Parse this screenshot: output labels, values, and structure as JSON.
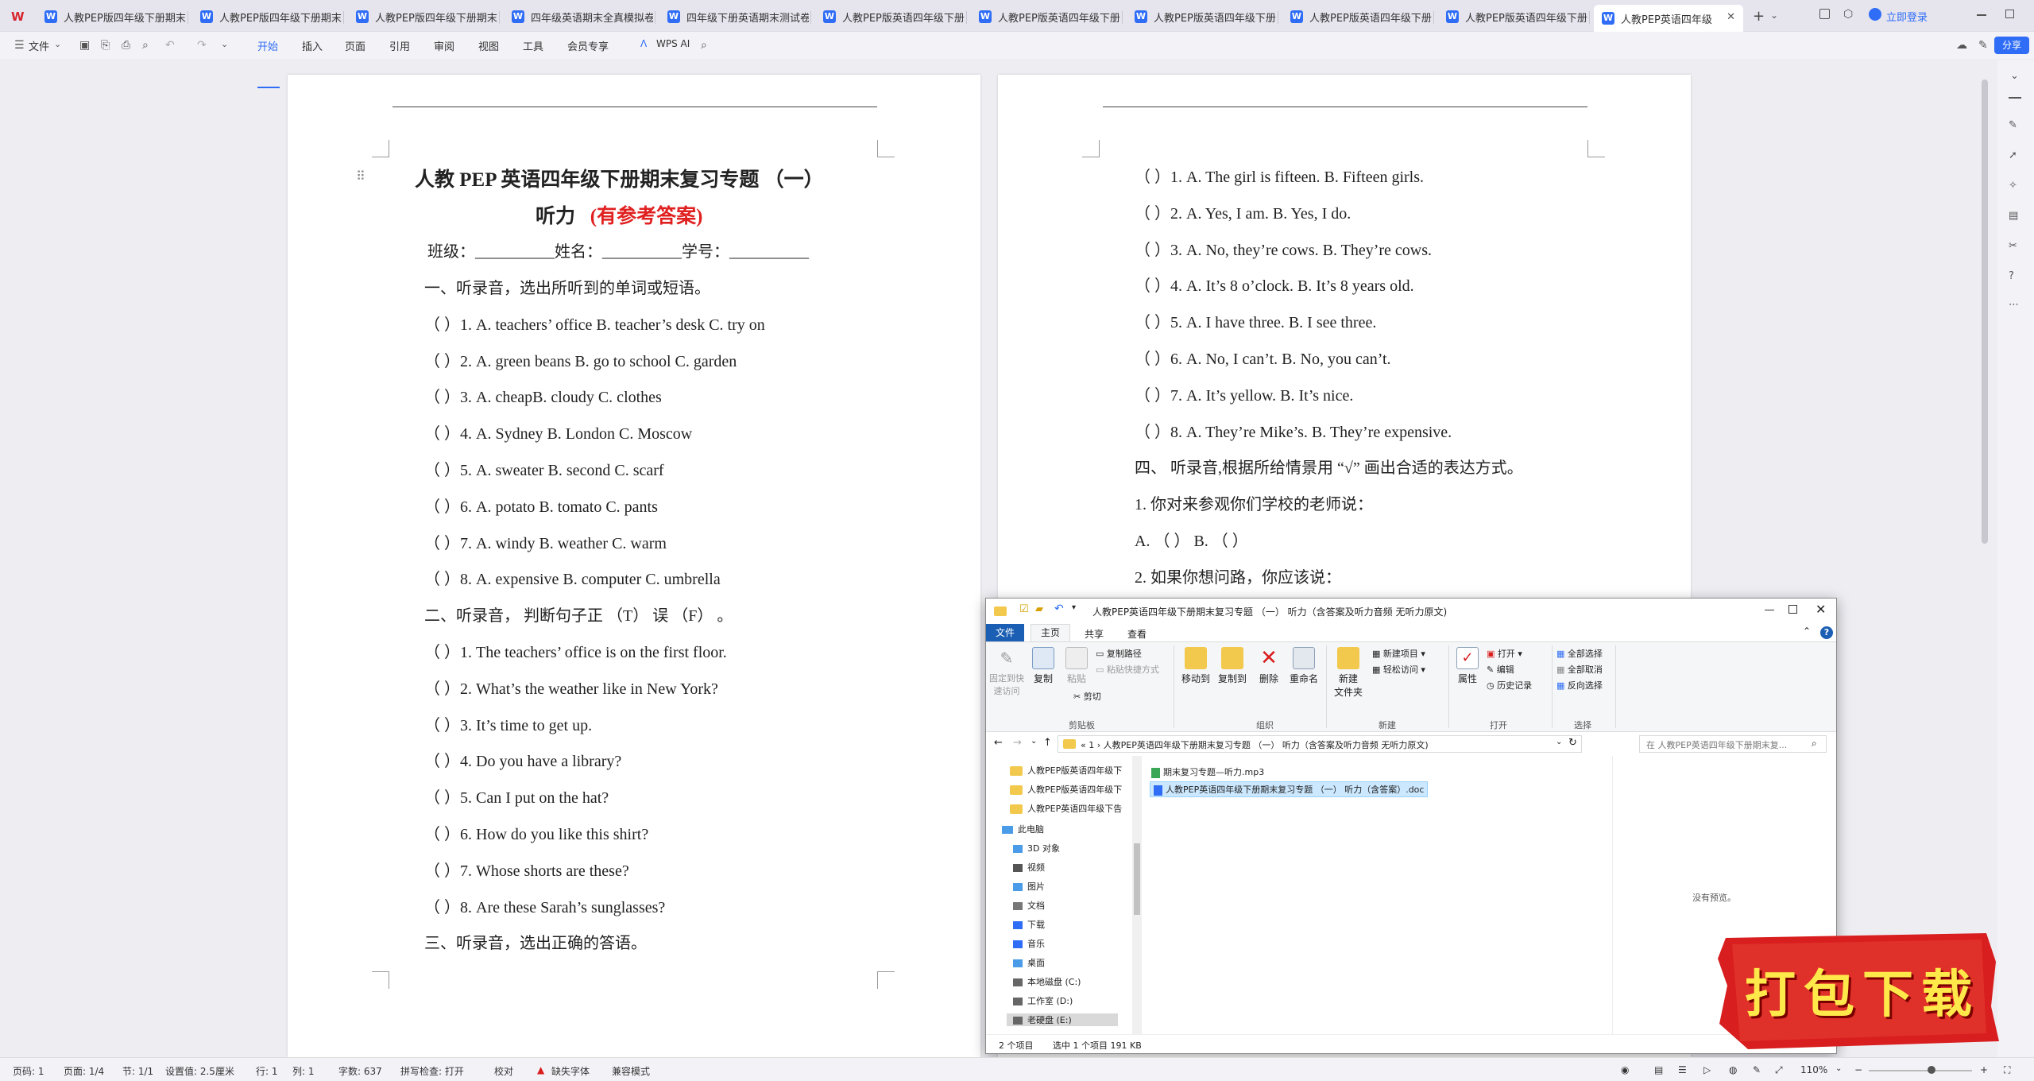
{
  "tabs": [
    {
      "label": "人教PEP版四年级下册期末"
    },
    {
      "label": "人教PEP版四年级下册期末"
    },
    {
      "label": "人教PEP版四年级下册期末"
    },
    {
      "label": "四年级英语期末全真模拟卷"
    },
    {
      "label": "四年级下册英语期末测试卷"
    },
    {
      "label": "人教PEP版英语四年级下册"
    },
    {
      "label": "人教PEP版英语四年级下册"
    },
    {
      "label": "人教PEP版英语四年级下册"
    },
    {
      "label": "人教PEP版英语四年级下册"
    },
    {
      "label": "人教PEP版英语四年级下册"
    },
    {
      "label": "人教PEP英语四年级"
    }
  ],
  "login": "立即登录",
  "share": "分享",
  "toolbar": {
    "file": "文件",
    "menus": [
      "开始",
      "插入",
      "页面",
      "引用",
      "审阅",
      "视图",
      "工具",
      "会员专享"
    ],
    "wps_ai": "WPS AI"
  },
  "page1": {
    "title1": "人教 PEP 英语四年级下册期末复习专题 （一）",
    "title2": "听力",
    "title2_red": "(有参考答案)",
    "info": "班级：__________姓名：__________学号：__________",
    "lines": [
      "一、听录音，选出所听到的单词或短语。",
      "（        ）1. A. teachers’ office      B. teacher’s desk     C. try on",
      "（        ）2. A. green beans  B. go to school     C. garden",
      "（        ）3. A. cheapB. cloudy   C. clothes",
      "（        ）4. A. Sydney     B. London C. Moscow",
      "（        ）5. A. sweater     B. second   C. scarf",
      "（        ）6. A. potato       B. tomato   C. pants",
      "（        ）7. A. windy        B. weather C. warm",
      "（        ）8. A. expensive             B. computer            C. umbrella",
      "二、听录音， 判断句子正  （T）  误  （F）  。",
      "（        ）1. The teachers’ office is on the first floor.",
      "（        ）2. What’s the weather like in New York?",
      "（        ）3. It’s time to get up.",
      "（        ）4. Do you have a library?",
      "（        ）5. Can I put on the hat?",
      "（        ）6. How do you like this shirt?",
      "（        ）7. Whose shorts are these?",
      "（        ）8. Are these Sarah’s sunglasses?",
      "三、听录音，选出正确的答语。"
    ]
  },
  "page2": {
    "lines": [
      "（        ）1. A. The girl is fifteen.     B. Fifteen girls.",
      "（        ）2. A. Yes, I am.       B. Yes, I do.",
      "（        ）3. A. No, they’re cows.      B. They’re cows.",
      "（        ）4. A. It’s 8 o’clock.        B. It’s 8 years old.",
      "（        ）5. A. I have three.        B. I see three.",
      "（        ）6. A. No, I can’t.    B. No, you can’t.",
      "（        ）7. A. It’s yellow.    B. It’s nice.",
      "（        ）8. A. They’re Mike’s. B. They’re expensive.",
      "四、  听录音,根据所给情景用 “√” 画出合适的表达方式。",
      "1.  你对来参观你们学校的老师说：",
      "        A.  （        ）                  B.  （        ）",
      "2.  如果你想问路，你应该说："
    ]
  },
  "explorer": {
    "title": "人教PEP英语四年级下册期末复习专题 （一） 听力（含答案及听力音频 无听力原文)",
    "ribbon_tabs": [
      "文件",
      "主页",
      "共享",
      "查看"
    ],
    "clipboard": {
      "pin": "固定到快\n速访问",
      "copy": "复制",
      "paste": "粘贴",
      "copy_path": "复制路径",
      "paste_shortcut": "粘贴快捷方式",
      "cut": "剪切",
      "group": "剪贴板"
    },
    "organize": {
      "move_to": "移动到",
      "copy_to": "复制到",
      "delete": "删除",
      "rename": "重命名",
      "group": "组织"
    },
    "new": {
      "new_folder": "新建\n文件夹",
      "new_item": "新建项目",
      "easy_access": "轻松访问",
      "group": "新建"
    },
    "open": {
      "properties": "属性",
      "open": "打开",
      "edit": "编辑",
      "history": "历史记录",
      "group": "打开"
    },
    "select": {
      "all": "全部选择",
      "none": "全部取消",
      "invert": "反向选择",
      "group": "选择"
    },
    "breadcrumb": "«  1  ›  人教PEP英语四年级下册期末复习专题 （一） 听力（含答案及听力音频 无听力原文)",
    "search_placeholder": "在 人教PEP英语四年级下册期末复...",
    "nav_folders": [
      "人教PEP版英语四年级下",
      "人教PEP版英语四年级下",
      "人教PEP英语四年级下告"
    ],
    "nav_this_pc": "此电脑",
    "nav_items": [
      "3D 对象",
      "视频",
      "图片",
      "文档",
      "下载",
      "音乐",
      "桌面",
      "本地磁盘 (C:)",
      "工作室 (D:)",
      "老硬盘 (E:)"
    ],
    "files": [
      "期末复习专题—听力.mp3",
      "人教PEP英语四年级下册期末复习专题 （一） 听力（含答案）.doc"
    ],
    "no_preview": "没有预览。",
    "status_count": "2 个项目",
    "status_selected": "选中 1 个项目  191 KB"
  },
  "banner": "打包下载",
  "statusbar": {
    "page": "页码: 1",
    "pages": "页面: 1/4",
    "section": "节: 1/1",
    "setting": "设置值: 2.5厘米",
    "row": "行: 1",
    "col": "列: 1",
    "words": "字数: 637",
    "spell": "拼写检查: 打开",
    "proof": "校对",
    "missing_font": "缺失字体",
    "compat": "兼容模式",
    "zoom": "110%"
  },
  "colors": {
    "accent": "#2f6df6",
    "red_text": "#e02020",
    "banner_red": "#d81e1e",
    "banner_text": "#ffe94a"
  }
}
